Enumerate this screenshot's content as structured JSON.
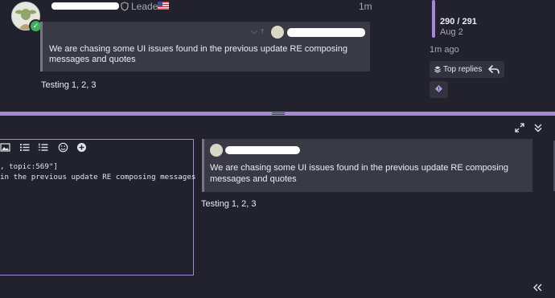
{
  "post": {
    "flair": "Leader",
    "age": "1m",
    "quote_text": "We are chasing some UI issues found in the previous update RE composing messages and quotes",
    "body": "Testing 1, 2, 3"
  },
  "timeline": {
    "count": "290 / 291",
    "date": "Aug 2",
    "ago": "1m ago",
    "top_replies_label": "Top replies"
  },
  "composer": {
    "editor_lines": [
      ", topic:569\"]",
      "in the previous update RE composing messages"
    ],
    "preview_quote_text": "We are chasing some UI issues found in the previous update RE composing messages and quotes",
    "preview_body": "Testing 1, 2, 3"
  },
  "colors": {
    "accent": "#a487d6",
    "background": "#22222e",
    "quote_bg": "#3a3a46",
    "online_badge": "#3fae5a"
  },
  "icons": [
    "shield-icon",
    "us-flag-icon",
    "chevron-down-icon",
    "arrow-up-icon",
    "stack-icon",
    "reply-icon",
    "flag-icon",
    "image-icon",
    "bullet-list-icon",
    "numbered-list-icon",
    "emoji-icon",
    "plus-circle-icon",
    "expand-icon",
    "collapse-icon",
    "double-chevron-left-icon"
  ]
}
